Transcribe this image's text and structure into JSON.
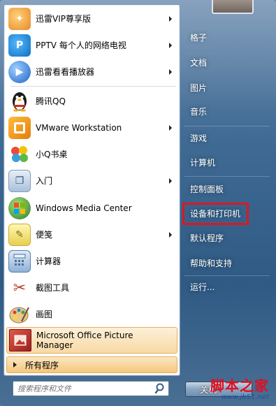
{
  "programs": [
    {
      "label": "迅雷VIP尊享版",
      "icon": "xunlei-vip-icon",
      "has_arrow": true,
      "color": "#f2a34a"
    },
    {
      "label": "PPTV 每个人的网络电视",
      "icon": "pptv-icon",
      "has_arrow": true,
      "color": "#1d8fe1"
    },
    {
      "label": "迅雷看看播放器",
      "icon": "xunlei-kankan-icon",
      "has_arrow": true,
      "color": "#2e7bd8"
    },
    {
      "label": "腾讯QQ",
      "icon": "qq-penguin-icon",
      "has_arrow": false,
      "color": "#1b1b1b"
    },
    {
      "label": "VMware Workstation",
      "icon": "vmware-icon",
      "has_arrow": true,
      "color": "#f5a316"
    },
    {
      "label": "小Q书桌",
      "icon": "q-desk-icon",
      "has_arrow": false,
      "color": "#e3473f"
    },
    {
      "label": "入门",
      "icon": "getting-started-icon",
      "has_arrow": true,
      "color": "#6b8fb8"
    },
    {
      "label": "Windows Media Center",
      "icon": "windows-media-center-icon",
      "has_arrow": false,
      "color": "#3d8f3d"
    },
    {
      "label": "便笺",
      "icon": "sticky-notes-icon",
      "has_arrow": true,
      "color": "#c9a43c"
    },
    {
      "label": "计算器",
      "icon": "calculator-icon",
      "has_arrow": false,
      "color": "#5a8bc2"
    },
    {
      "label": "截图工具",
      "icon": "snipping-tool-icon",
      "has_arrow": false,
      "color": "#c0392b"
    },
    {
      "label": "画图",
      "icon": "paint-icon",
      "has_arrow": false,
      "color": "#d08a2d"
    },
    {
      "label": "Microsoft Office Picture Manager",
      "icon": "picture-manager-icon",
      "has_arrow": false,
      "color": "#b02a2a",
      "highlighted": true
    }
  ],
  "all_programs_label": "所有程序",
  "search": {
    "placeholder": "搜索程序和文件"
  },
  "right_pane": [
    "格子",
    "文档",
    "图片",
    "音乐",
    "游戏",
    "计算机",
    "控制面板",
    "设备和打印机",
    "默认程序",
    "帮助和支持",
    "运行..."
  ],
  "shutdown_label": "关机",
  "watermark": {
    "title": "脚本之家",
    "url": "www.jb51.net"
  },
  "colors": {
    "highlight_box": "#e0161e",
    "accent": "#f5c77c"
  }
}
